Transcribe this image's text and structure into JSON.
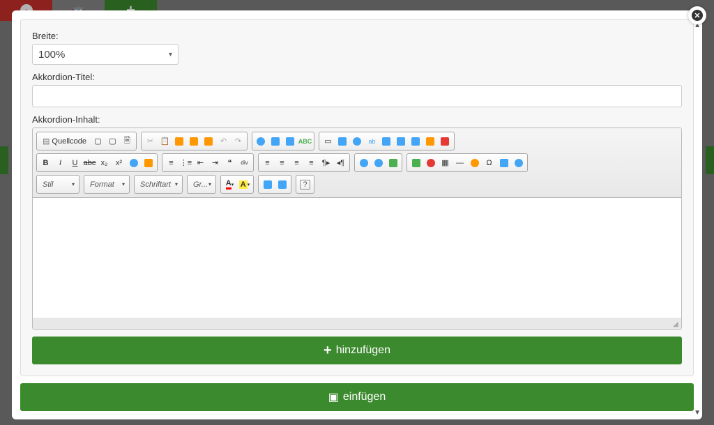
{
  "form": {
    "width_label": "Breite:",
    "width_value": "100%",
    "title_label": "Akkordion-Titel:",
    "title_value": "",
    "content_label": "Akkordion-Inhalt:"
  },
  "editor": {
    "source_label": "Quellcode",
    "combos": {
      "style": "Stil",
      "format": "Format",
      "font": "Schriftart",
      "size": "Gr..."
    }
  },
  "buttons": {
    "add": "hinzufügen",
    "insert": "einfügen"
  }
}
